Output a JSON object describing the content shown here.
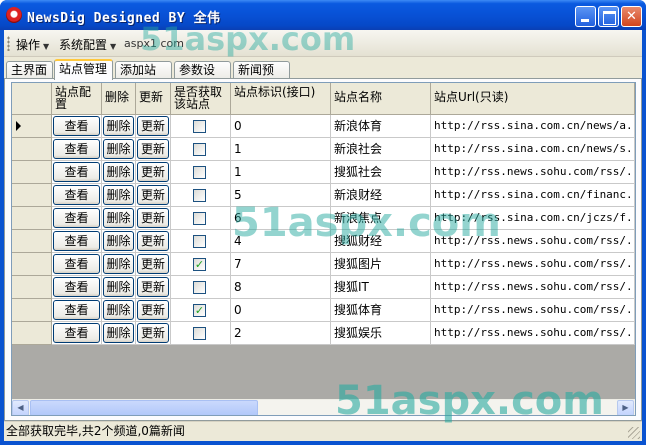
{
  "window": {
    "title": "NewsDig Designed BY 全伟",
    "minimize_label": "",
    "maximize_label": "",
    "close_label": ""
  },
  "menubar": {
    "items": [
      {
        "label": "操作"
      },
      {
        "label": "系统配置"
      }
    ],
    "link_text": "aspx1 com"
  },
  "tabs": [
    {
      "label": "主界面"
    },
    {
      "label": "站点管理",
      "active": true
    },
    {
      "label": "添加站点"
    },
    {
      "label": "参数设置"
    },
    {
      "label": "新闻预览"
    }
  ],
  "grid": {
    "columns": [
      "",
      "站点配置",
      "删除",
      "更新",
      "是否获取该站点",
      "站点标识(接口)",
      "站点名称",
      "站点Url(只读)"
    ],
    "button_labels": {
      "config": "查看",
      "delete": "删除",
      "update": "更新"
    },
    "rows": [
      {
        "selected": true,
        "checked": false,
        "id": "0",
        "name": "新浪体育",
        "url": "http://rss.sina.com.cn/news/a..."
      },
      {
        "selected": false,
        "checked": false,
        "id": "1",
        "name": "新浪社会",
        "url": "http://rss.sina.com.cn/news/s..."
      },
      {
        "selected": false,
        "checked": false,
        "id": "1",
        "name": "搜狐社会",
        "url": "http://rss.news.sohu.com/rss/..."
      },
      {
        "selected": false,
        "checked": false,
        "id": "5",
        "name": "新浪财经",
        "url": "http://rss.sina.com.cn/financ..."
      },
      {
        "selected": false,
        "checked": false,
        "id": "6",
        "name": "新浪焦点",
        "url": "http://rss.sina.com.cn/jczs/f..."
      },
      {
        "selected": false,
        "checked": false,
        "id": "4",
        "name": "搜狐财经",
        "url": "http://rss.news.sohu.com/rss/..."
      },
      {
        "selected": false,
        "checked": true,
        "id": "7",
        "name": "搜狐图片",
        "url": "http://rss.news.sohu.com/rss/..."
      },
      {
        "selected": false,
        "checked": false,
        "id": "8",
        "name": "搜狐IT",
        "url": "http://rss.news.sohu.com/rss/..."
      },
      {
        "selected": false,
        "checked": true,
        "id": "0",
        "name": "搜狐体育",
        "url": "http://rss.news.sohu.com/rss/..."
      },
      {
        "selected": false,
        "checked": false,
        "id": "2",
        "name": "搜狐娱乐",
        "url": "http://rss.news.sohu.com/rss/..."
      }
    ]
  },
  "status": {
    "text": "全部获取完毕,共2个频道,0篇新闻"
  },
  "watermarks": [
    "51aspx.com",
    "51aspx.com",
    "51aspx.com"
  ],
  "colors": {
    "title_bar": "#0851d6",
    "chrome": "#ece9d8",
    "check_mark": "#21a121",
    "watermark": "#28aaa0"
  },
  "icons": {
    "app": "app-logo-icon",
    "row_indicator": "current-row-arrow-icon"
  }
}
